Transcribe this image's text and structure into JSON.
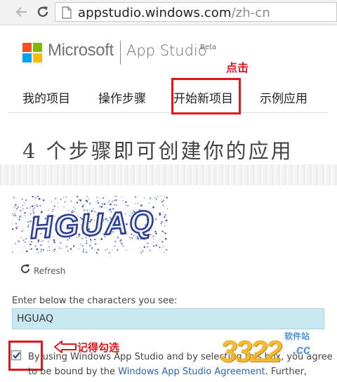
{
  "browser": {
    "url_host": "appstudio.windows.com",
    "url_path": "/zh-cn",
    "icons": [
      "back-arrow-icon",
      "reload-icon",
      "page-icon"
    ]
  },
  "header": {
    "brand": "Microsoft",
    "product": "App Studio",
    "badge": "Beta",
    "logo_colors": [
      "#f25022",
      "#7fba00",
      "#00a4ef",
      "#ffb900"
    ]
  },
  "nav": {
    "items": [
      {
        "label": "我的项目"
      },
      {
        "label": "操作步骤"
      },
      {
        "label": "开始新项目"
      },
      {
        "label": "示例应用"
      }
    ]
  },
  "annotations": {
    "click": "点击",
    "remember": "记得勾选",
    "color": "#e4151b"
  },
  "hero": {
    "headline": "4 个步骤即可创建你的应用"
  },
  "captcha": {
    "image_text": "HGUAQ",
    "refresh_label": "Refresh",
    "field_label": "Enter below the characters you see:",
    "field_value": "HGUAQ",
    "field_bg": "#c8e8f2"
  },
  "agreement": {
    "checked": true,
    "line1_pre": "By using Windows App Studio and by se",
    "line1_obscured": "lecting this box, you",
    "line1_post": " agree",
    "line2_pre": "to be bound by the ",
    "link": "Windows App Studio Agreement",
    "line2_post": ". Further,"
  },
  "watermark": {
    "number": "3322",
    "domain": ".cc",
    "site_name": "软件站"
  }
}
